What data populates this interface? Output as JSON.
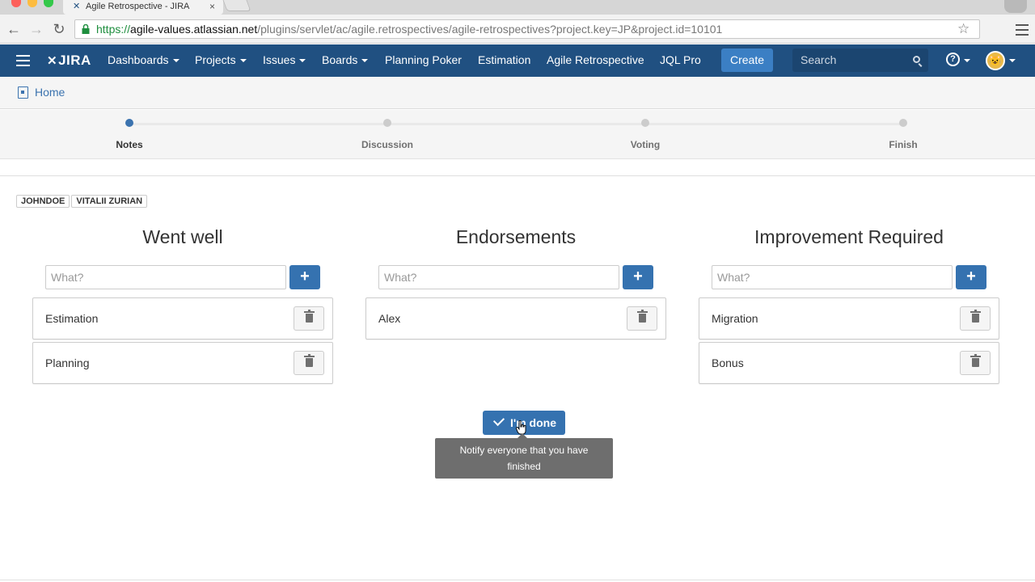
{
  "browser": {
    "tab_title": "Agile Retrospective - JIRA",
    "tab_close": "×",
    "url_scheme": "https://",
    "url_host": "agile-values.atlassian.net",
    "url_path": "/plugins/servlet/ac/agile.retrospectives/agile-retrospectives?project.key=JP&project.id=10101",
    "back_icon": "←",
    "forward_icon": "→",
    "reload_icon": "↻",
    "star_icon": "☆"
  },
  "header": {
    "logo": "JIRA",
    "logo_mark": "✕",
    "nav": [
      {
        "label": "Dashboards",
        "dropdown": true
      },
      {
        "label": "Projects",
        "dropdown": true
      },
      {
        "label": "Issues",
        "dropdown": true
      },
      {
        "label": "Boards",
        "dropdown": true
      },
      {
        "label": "Planning Poker",
        "dropdown": false
      },
      {
        "label": "Estimation",
        "dropdown": false
      },
      {
        "label": "Agile Retrospective",
        "dropdown": false
      },
      {
        "label": "JQL Pro",
        "dropdown": false
      }
    ],
    "create_label": "Create",
    "search_placeholder": "Search",
    "help_icon": "?",
    "avatar_glyph": "😺"
  },
  "breadcrumb": {
    "home_label": "Home"
  },
  "stepper": {
    "steps": [
      {
        "label": "Notes",
        "active": true
      },
      {
        "label": "Discussion",
        "active": false
      },
      {
        "label": "Voting",
        "active": false
      },
      {
        "label": "Finish",
        "active": false
      }
    ]
  },
  "participants": [
    "JOHNDOE",
    "VITALII ZURIAN"
  ],
  "columns": [
    {
      "title": "Went well",
      "placeholder": "What?",
      "add_label": "+",
      "items": [
        "Estimation",
        "Planning"
      ]
    },
    {
      "title": "Endorsements",
      "placeholder": "What?",
      "add_label": "+",
      "items": [
        "Alex"
      ]
    },
    {
      "title": "Improvement Required",
      "placeholder": "What?",
      "add_label": "+",
      "items": [
        "Migration",
        "Bonus"
      ]
    }
  ],
  "done_button": {
    "label": "I'm done"
  },
  "tooltip": {
    "text": "Notify everyone that you have finished"
  },
  "colors": {
    "brand": "#205081",
    "primary_button": "#3572b0",
    "link": "#3b73af"
  }
}
